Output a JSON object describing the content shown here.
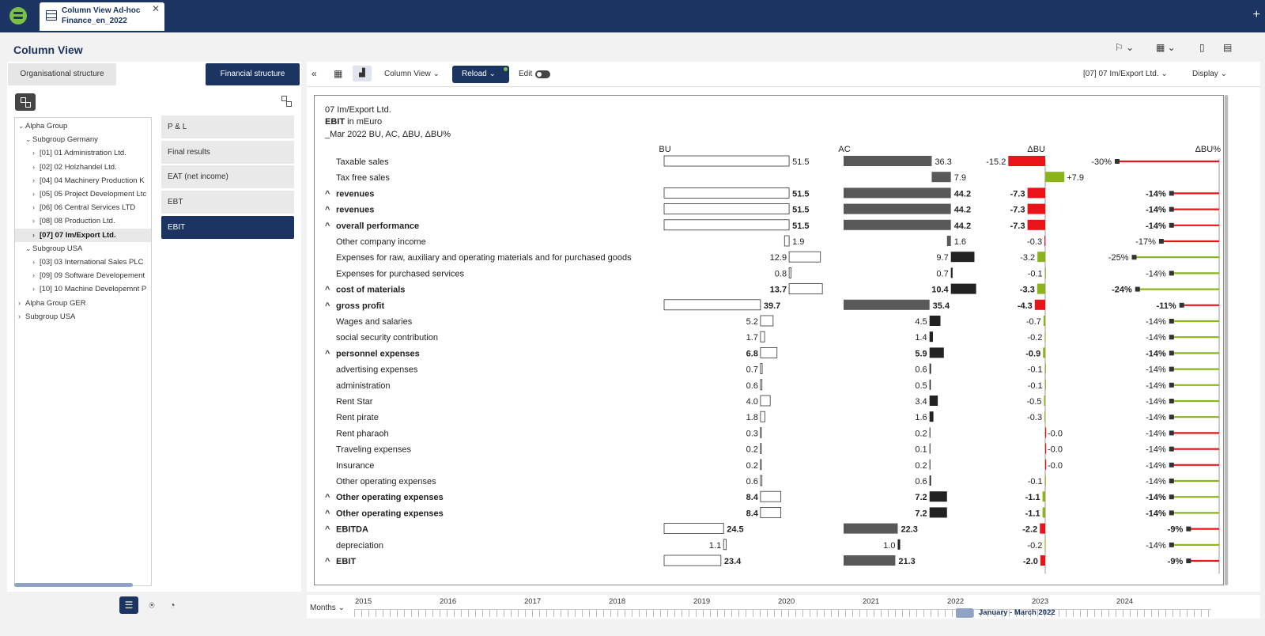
{
  "app": {
    "tab_title_line1": "Column View Ad-hoc",
    "tab_title_line2": "Finance_en_2022",
    "close_label": "✕",
    "new_tab_label": "+"
  },
  "header": {
    "title": "Column View",
    "icons": [
      "flag-icon",
      "excel-icon",
      "page-icon",
      "print-icon"
    ]
  },
  "left": {
    "tab_org": "Organisational structure",
    "tab_fin": "Financial structure",
    "tree": [
      {
        "label": "Alpha Group",
        "level": 0,
        "expanded": true
      },
      {
        "label": "Subgroup Germany",
        "level": 1,
        "expanded": true
      },
      {
        "label": "[01] 01 Administration Ltd.",
        "level": 2,
        "expanded": false
      },
      {
        "label": "[02] 02 Holzhandel Ltd.",
        "level": 2,
        "expanded": false
      },
      {
        "label": "[04] 04 Machinery Production K",
        "level": 2,
        "expanded": false
      },
      {
        "label": "[05] 05 Project Development Ltc",
        "level": 2,
        "expanded": false
      },
      {
        "label": "[06] 06 Central Services LTD",
        "level": 2,
        "expanded": false
      },
      {
        "label": "[08] 08 Production Ltd.",
        "level": 2,
        "expanded": false
      },
      {
        "label": "[07] 07 Im/Export Ltd.",
        "level": 2,
        "expanded": false,
        "selected": true
      },
      {
        "label": "Subgroup USA",
        "level": 1,
        "expanded": true
      },
      {
        "label": "[03] 03 International Sales PLC",
        "level": 2,
        "expanded": false
      },
      {
        "label": "[09] 09 Software Developement",
        "level": 2,
        "expanded": false
      },
      {
        "label": "[10] 10 Machine Developemnt P",
        "level": 2,
        "expanded": false
      },
      {
        "label": "Alpha Group GER",
        "level": 0,
        "expanded": false
      },
      {
        "label": "Subgroup USA",
        "level": 0,
        "expanded": false
      }
    ],
    "fin_items": [
      "P & L",
      "Final results",
      "EAT (net income)",
      "EBT",
      "EBIT"
    ],
    "fin_active": "EBIT"
  },
  "toolbar": {
    "view_select": "Column View",
    "reload_label": "Reload",
    "edit_label": "Edit",
    "entity_select": "[07] 07 Im/Export Ltd.",
    "display_label": "Display"
  },
  "chart_header": {
    "entity": "07 Im/Export Ltd.",
    "measure_bold": "EBIT",
    "measure_rest": " in mEuro",
    "period": "_Mar 2022 BU, AC, ΔBU, ΔBU%"
  },
  "chart_data": {
    "type": "table",
    "columns": [
      "BU",
      "AC",
      "ΔBU",
      "ΔBU%"
    ],
    "colors": {
      "red": "#e8141a",
      "green": "#8ab31c",
      "ac_sum": "#595959",
      "ac_cost": "#222222"
    },
    "rows": [
      {
        "label": "Taxable sales",
        "bu": "51.5",
        "ac": "36.3",
        "dbu": "-15.2",
        "dbup": "-30%",
        "bold": false,
        "sub": false,
        "cost": false
      },
      {
        "label": "Tax free sales",
        "bu": "",
        "ac": "7.9",
        "dbu": "+7.9",
        "dbup": "",
        "bold": false,
        "sub": false,
        "cost": false
      },
      {
        "label": "revenues",
        "bu": "51.5",
        "ac": "44.2",
        "dbu": "-7.3",
        "dbup": "-14%",
        "bold": true,
        "sub": true,
        "cost": false
      },
      {
        "label": "revenues",
        "bu": "51.5",
        "ac": "44.2",
        "dbu": "-7.3",
        "dbup": "-14%",
        "bold": true,
        "sub": true,
        "cost": false
      },
      {
        "label": "overall performance",
        "bu": "51.5",
        "ac": "44.2",
        "dbu": "-7.3",
        "dbup": "-14%",
        "bold": true,
        "sub": true,
        "cost": false
      },
      {
        "label": "Other company income",
        "bu": "1.9",
        "ac": "1.6",
        "dbu": "-0.3",
        "dbup": "-17%",
        "bold": false,
        "sub": false,
        "cost": false
      },
      {
        "label": "Expenses for raw, auxiliary and operating materials and for purchased goods",
        "bu": "12.9",
        "ac": "9.7",
        "dbu": "-3.2",
        "dbup": "-25%",
        "bold": false,
        "sub": false,
        "cost": true
      },
      {
        "label": "Expenses for purchased services",
        "bu": "0.8",
        "ac": "0.7",
        "dbu": "-0.1",
        "dbup": "-14%",
        "bold": false,
        "sub": false,
        "cost": true
      },
      {
        "label": "cost of materials",
        "bu": "13.7",
        "ac": "10.4",
        "dbu": "-3.3",
        "dbup": "-24%",
        "bold": true,
        "sub": true,
        "cost": true
      },
      {
        "label": "gross profit",
        "bu": "39.7",
        "ac": "35.4",
        "dbu": "-4.3",
        "dbup": "-11%",
        "bold": true,
        "sub": true,
        "cost": false
      },
      {
        "label": "Wages and salaries",
        "bu": "5.2",
        "ac": "4.5",
        "dbu": "-0.7",
        "dbup": "-14%",
        "bold": false,
        "sub": false,
        "cost": true
      },
      {
        "label": "social security contribution",
        "bu": "1.7",
        "ac": "1.4",
        "dbu": "-0.2",
        "dbup": "-14%",
        "bold": false,
        "sub": false,
        "cost": true
      },
      {
        "label": "personnel expenses",
        "bu": "6.8",
        "ac": "5.9",
        "dbu": "-0.9",
        "dbup": "-14%",
        "bold": true,
        "sub": true,
        "cost": true
      },
      {
        "label": "advertising expenses",
        "bu": "0.7",
        "ac": "0.6",
        "dbu": "-0.1",
        "dbup": "-14%",
        "bold": false,
        "sub": false,
        "cost": true
      },
      {
        "label": "administration",
        "bu": "0.6",
        "ac": "0.5",
        "dbu": "-0.1",
        "dbup": "-14%",
        "bold": false,
        "sub": false,
        "cost": true
      },
      {
        "label": "Rent Star",
        "bu": "4.0",
        "ac": "3.4",
        "dbu": "-0.5",
        "dbup": "-14%",
        "bold": false,
        "sub": false,
        "cost": true
      },
      {
        "label": "Rent pirate",
        "bu": "1.8",
        "ac": "1.6",
        "dbu": "-0.3",
        "dbup": "-14%",
        "bold": false,
        "sub": false,
        "cost": true
      },
      {
        "label": "Rent pharaoh",
        "bu": "0.3",
        "ac": "0.2",
        "dbu": "-0.0",
        "dbup": "-14%",
        "bold": false,
        "sub": false,
        "cost": true
      },
      {
        "label": "Traveling expenses",
        "bu": "0.2",
        "ac": "0.1",
        "dbu": "-0.0",
        "dbup": "-14%",
        "bold": false,
        "sub": false,
        "cost": true
      },
      {
        "label": "Insurance",
        "bu": "0.2",
        "ac": "0.2",
        "dbu": "-0.0",
        "dbup": "-14%",
        "bold": false,
        "sub": false,
        "cost": true
      },
      {
        "label": "Other operating expenses",
        "bu": "0.6",
        "ac": "0.6",
        "dbu": "-0.1",
        "dbup": "-14%",
        "bold": false,
        "sub": false,
        "cost": true
      },
      {
        "label": "Other operating expenses",
        "bu": "8.4",
        "ac": "7.2",
        "dbu": "-1.1",
        "dbup": "-14%",
        "bold": true,
        "sub": true,
        "cost": true
      },
      {
        "label": "Other operating expenses",
        "bu": "8.4",
        "ac": "7.2",
        "dbu": "-1.1",
        "dbup": "-14%",
        "bold": true,
        "sub": true,
        "cost": true
      },
      {
        "label": "EBITDA",
        "bu": "24.5",
        "ac": "22.3",
        "dbu": "-2.2",
        "dbup": "-9%",
        "bold": true,
        "sub": true,
        "cost": false
      },
      {
        "label": "depreciation",
        "bu": "1.1",
        "ac": "1.0",
        "dbu": "-0.2",
        "dbup": "-14%",
        "bold": false,
        "sub": false,
        "cost": true
      },
      {
        "label": "EBIT",
        "bu": "23.4",
        "ac": "21.3",
        "dbu": "-2.0",
        "dbup": "-9%",
        "bold": true,
        "sub": true,
        "cost": false
      }
    ]
  },
  "timeline": {
    "mode": "Months",
    "years": [
      "2015",
      "2016",
      "2017",
      "2018",
      "2019",
      "2020",
      "2021",
      "2022",
      "2023",
      "2024"
    ],
    "selection": "January - March 2022"
  }
}
